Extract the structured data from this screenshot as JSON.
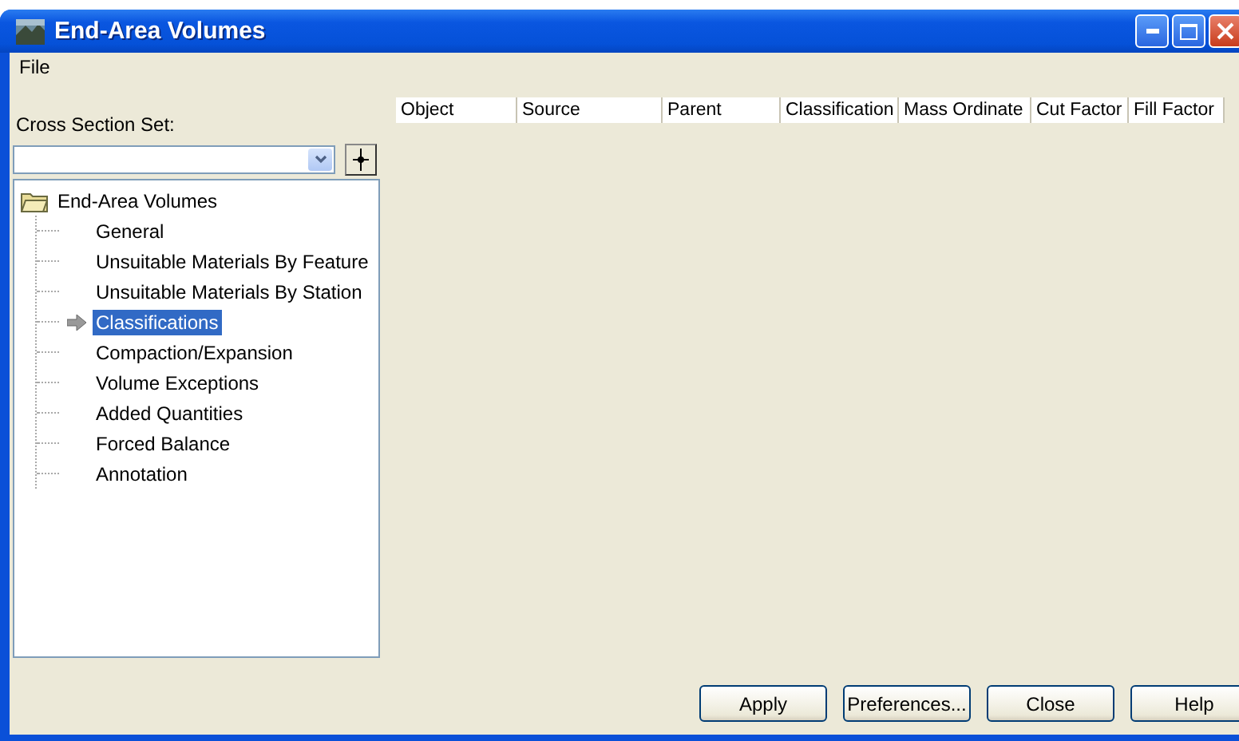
{
  "window": {
    "title": "End-Area Volumes"
  },
  "menu": [
    "File"
  ],
  "cross_section_set": {
    "label": "Cross Section Set:"
  },
  "tree": {
    "label": "End-Area Volumes",
    "expanded": true,
    "children": [
      {
        "label": "General",
        "selected": false
      },
      {
        "label": "Unsuitable Materials By Feature",
        "selected": false
      },
      {
        "label": "Unsuitable Materials By Station",
        "selected": false
      },
      {
        "label": "Classifications",
        "selected": true
      },
      {
        "label": "Compaction/Expansion",
        "selected": false
      },
      {
        "label": "Volume Exceptions",
        "selected": false
      },
      {
        "label": "Added Quantities",
        "selected": false
      },
      {
        "label": "Forced Balance",
        "selected": false
      },
      {
        "label": "Annotation",
        "selected": false
      }
    ]
  },
  "table": {
    "columns": [
      "Object",
      "Source",
      "Parent",
      "Classification",
      "Mass Ordinate",
      "Cut Factor",
      "Fill Factor"
    ]
  },
  "buttons": [
    "Apply",
    "Preferences...",
    "Close",
    "Help"
  ]
}
